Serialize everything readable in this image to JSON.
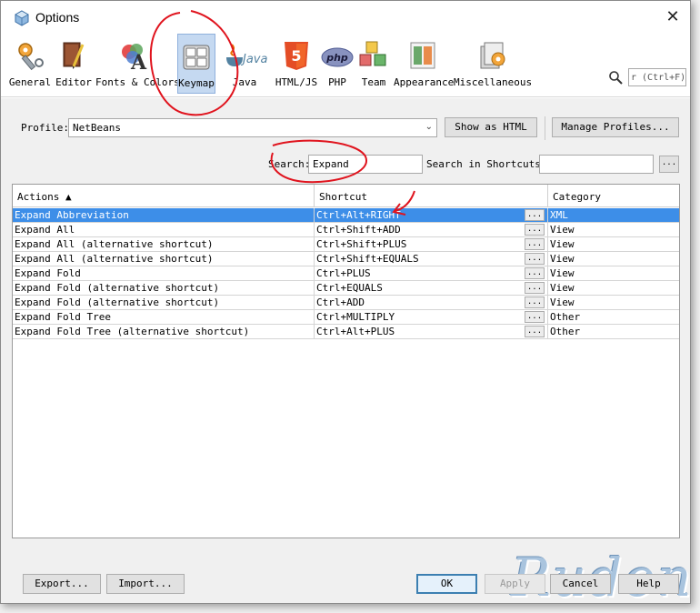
{
  "window": {
    "title": "Options"
  },
  "categories": [
    {
      "label": "General",
      "icon": "wrench-gear-icon"
    },
    {
      "label": "Editor",
      "icon": "book-pen-icon"
    },
    {
      "label": "Fonts & Colors",
      "icon": "font-palette-icon"
    },
    {
      "label": "Keymap",
      "icon": "keyboard-icon",
      "selected": true
    },
    {
      "label": "Java",
      "icon": "java-cup-icon"
    },
    {
      "label": "HTML/JS",
      "icon": "html5-icon"
    },
    {
      "label": "PHP",
      "icon": "php-icon"
    },
    {
      "label": "Team",
      "icon": "team-blocks-icon"
    },
    {
      "label": "Appearance",
      "icon": "appearance-icon"
    },
    {
      "label": "Miscellaneous",
      "icon": "misc-icon"
    }
  ],
  "top_search": {
    "value": "r (Ctrl+F)"
  },
  "profile": {
    "label": "Profile:",
    "value": "NetBeans",
    "show_html": "Show as HTML",
    "manage": "Manage Profiles..."
  },
  "search": {
    "label": "Search:",
    "value": "Expand",
    "shortcuts_label": "Search in Shortcuts:",
    "shortcuts_value": "",
    "more": "..."
  },
  "table": {
    "headers": {
      "actions": "Actions ▲",
      "shortcut": "Shortcut",
      "category": "Category"
    },
    "ellipsis": "...",
    "rows": [
      {
        "action": "Expand Abbreviation",
        "shortcut": "Ctrl+Alt+RIGHT",
        "category": "XML"
      },
      {
        "action": "Expand All",
        "shortcut": "Ctrl+Shift+ADD",
        "category": "View"
      },
      {
        "action": "Expand All (alternative shortcut)",
        "shortcut": "Ctrl+Shift+PLUS",
        "category": "View"
      },
      {
        "action": "Expand All (alternative shortcut)",
        "shortcut": "Ctrl+Shift+EQUALS",
        "category": "View"
      },
      {
        "action": "Expand Fold",
        "shortcut": "Ctrl+PLUS",
        "category": "View"
      },
      {
        "action": "Expand Fold (alternative shortcut)",
        "shortcut": "Ctrl+EQUALS",
        "category": "View"
      },
      {
        "action": "Expand Fold (alternative shortcut)",
        "shortcut": "Ctrl+ADD",
        "category": "View"
      },
      {
        "action": "Expand Fold Tree",
        "shortcut": "Ctrl+MULTIPLY",
        "category": "Other"
      },
      {
        "action": "Expand Fold Tree (alternative shortcut)",
        "shortcut": "Ctrl+Alt+PLUS",
        "category": "Other"
      }
    ]
  },
  "watermark": "Rudon",
  "buttons": {
    "export": "Export...",
    "import": "Import...",
    "ok": "OK",
    "apply": "Apply",
    "cancel": "Cancel",
    "help": "Help"
  },
  "colors": {
    "selection": "#3d8ee8",
    "annotation": "#e0141e",
    "keymap_selected": "#c5d9f1"
  }
}
